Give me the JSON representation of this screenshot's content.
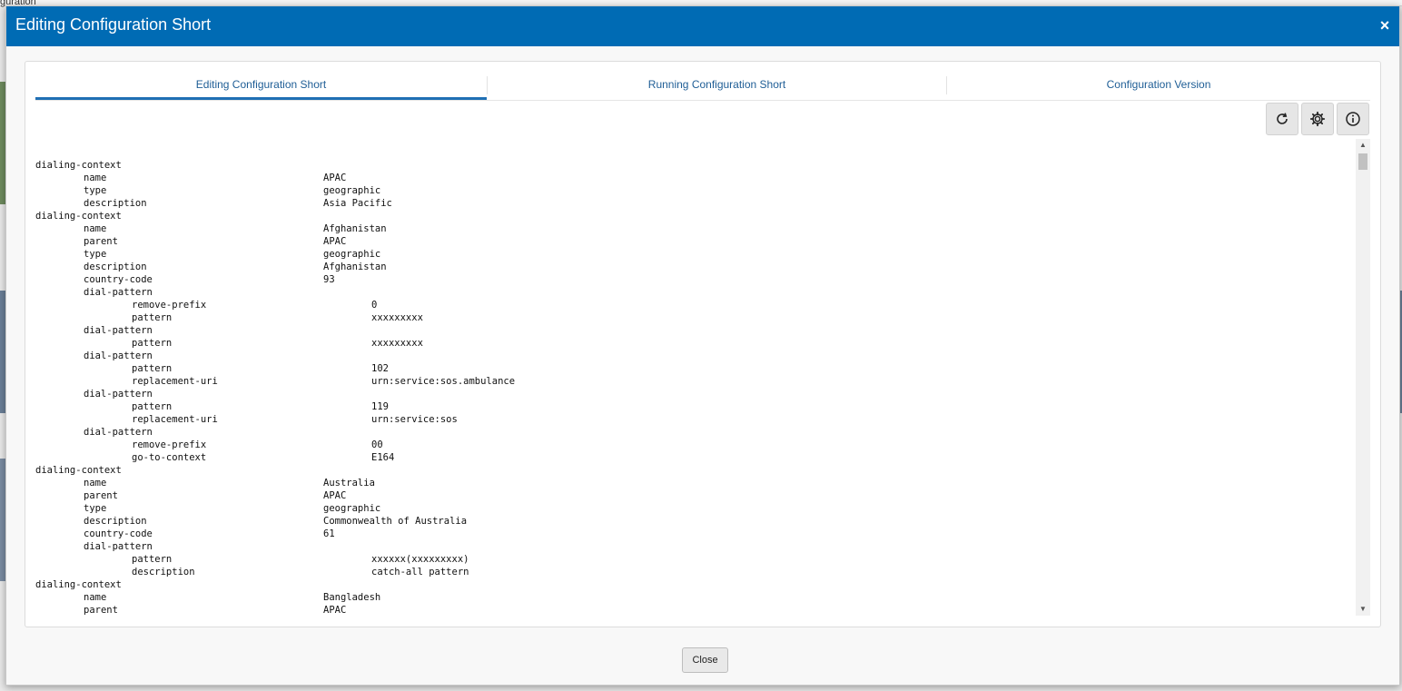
{
  "background": {
    "fragment_text": "guration"
  },
  "modal": {
    "title": "Editing Configuration Short",
    "close_icon": "×",
    "header_color": "#006bb4",
    "tabs": [
      {
        "label": "Editing Configuration Short",
        "active": true
      },
      {
        "label": "Running Configuration Short",
        "active": false
      },
      {
        "label": "Configuration Version",
        "active": false
      }
    ],
    "toolbar": [
      {
        "icon": "refresh-icon"
      },
      {
        "icon": "gear-icon"
      },
      {
        "icon": "info-icon"
      }
    ],
    "config_lines": [
      {
        "indent": 0,
        "key": "dialing-context",
        "value": ""
      },
      {
        "indent": 1,
        "key": "name",
        "value": "APAC"
      },
      {
        "indent": 1,
        "key": "type",
        "value": "geographic"
      },
      {
        "indent": 1,
        "key": "description",
        "value": "Asia Pacific"
      },
      {
        "indent": 0,
        "key": "dialing-context",
        "value": ""
      },
      {
        "indent": 1,
        "key": "name",
        "value": "Afghanistan"
      },
      {
        "indent": 1,
        "key": "parent",
        "value": "APAC"
      },
      {
        "indent": 1,
        "key": "type",
        "value": "geographic"
      },
      {
        "indent": 1,
        "key": "description",
        "value": "Afghanistan"
      },
      {
        "indent": 1,
        "key": "country-code",
        "value": "93"
      },
      {
        "indent": 1,
        "key": "dial-pattern",
        "value": ""
      },
      {
        "indent": 2,
        "key": "remove-prefix",
        "value": "0"
      },
      {
        "indent": 2,
        "key": "pattern",
        "value": "xxxxxxxxx"
      },
      {
        "indent": 1,
        "key": "dial-pattern",
        "value": ""
      },
      {
        "indent": 2,
        "key": "pattern",
        "value": "xxxxxxxxx"
      },
      {
        "indent": 1,
        "key": "dial-pattern",
        "value": ""
      },
      {
        "indent": 2,
        "key": "pattern",
        "value": "102"
      },
      {
        "indent": 2,
        "key": "replacement-uri",
        "value": "urn:service:sos.ambulance"
      },
      {
        "indent": 1,
        "key": "dial-pattern",
        "value": ""
      },
      {
        "indent": 2,
        "key": "pattern",
        "value": "119"
      },
      {
        "indent": 2,
        "key": "replacement-uri",
        "value": "urn:service:sos"
      },
      {
        "indent": 1,
        "key": "dial-pattern",
        "value": ""
      },
      {
        "indent": 2,
        "key": "remove-prefix",
        "value": "00"
      },
      {
        "indent": 2,
        "key": "go-to-context",
        "value": "E164"
      },
      {
        "indent": 0,
        "key": "dialing-context",
        "value": ""
      },
      {
        "indent": 1,
        "key": "name",
        "value": "Australia"
      },
      {
        "indent": 1,
        "key": "parent",
        "value": "APAC"
      },
      {
        "indent": 1,
        "key": "type",
        "value": "geographic"
      },
      {
        "indent": 1,
        "key": "description",
        "value": "Commonwealth of Australia"
      },
      {
        "indent": 1,
        "key": "country-code",
        "value": "61"
      },
      {
        "indent": 1,
        "key": "dial-pattern",
        "value": ""
      },
      {
        "indent": 2,
        "key": "pattern",
        "value": "xxxxxx(xxxxxxxxx)"
      },
      {
        "indent": 2,
        "key": "description",
        "value": "catch-all pattern"
      },
      {
        "indent": 0,
        "key": "dialing-context",
        "value": ""
      },
      {
        "indent": 1,
        "key": "name",
        "value": "Bangladesh"
      },
      {
        "indent": 1,
        "key": "parent",
        "value": "APAC"
      }
    ],
    "close_button_label": "Close"
  }
}
